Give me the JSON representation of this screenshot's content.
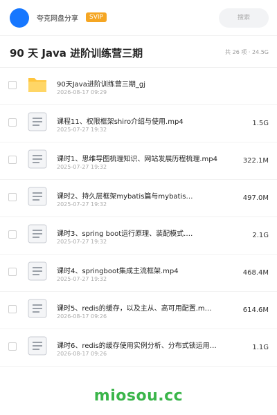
{
  "header": {
    "brand": "夸克网盘分享",
    "badge": "SVIP",
    "search_placeholder": "搜索",
    "avatar_color": "#1677ff"
  },
  "folder": {
    "title": "90 天 Java 进阶训练营三期",
    "summary": "共 26 项 · 24.5G"
  },
  "files": [
    {
      "icon": "folder-icon",
      "name": "90天Java进阶训练营三期_gj",
      "date": "2026-08-17 09:29",
      "size": ""
    },
    {
      "icon": "video-file-icon",
      "name": "课程11、权限框架shiro介绍与使用.mp4",
      "date": "2025-07-27 19:32",
      "size": "1.5G"
    },
    {
      "icon": "video-file-icon",
      "name": "课时1、思维导图梳理知识、网站发展历程梳理.mp4",
      "date": "2025-07-27 19:32",
      "size": "322.1M"
    },
    {
      "icon": "video-file-icon",
      "name": "课时2、持久层框架mybatis篇与mybatis…",
      "date": "2025-07-27 19:32",
      "size": "497.0M"
    },
    {
      "icon": "video-file-icon",
      "name": "课时3、spring boot运行原理、装配模式.…",
      "date": "2025-07-27 19:32",
      "size": "2.1G"
    },
    {
      "icon": "video-file-icon",
      "name": "课时4、springboot集成主流框架.mp4",
      "date": "2025-07-27 19:32",
      "size": "468.4M"
    },
    {
      "icon": "video-file-icon",
      "name": "课时5、redis的缓存，以及主从、高可用配置.m…",
      "date": "2026-08-17 09:26",
      "size": "614.6M"
    },
    {
      "icon": "video-file-icon",
      "name": "课时6、redis的缓存使用实例分析、分布式锁运用…",
      "date": "2026-08-17 09:26",
      "size": "1.1G"
    }
  ],
  "watermark": "miosou.cc",
  "colors": {
    "accent": "#1677ff",
    "folder": "#ffc53d",
    "badge": "#f5a623",
    "watermark": "#3ab54a"
  }
}
